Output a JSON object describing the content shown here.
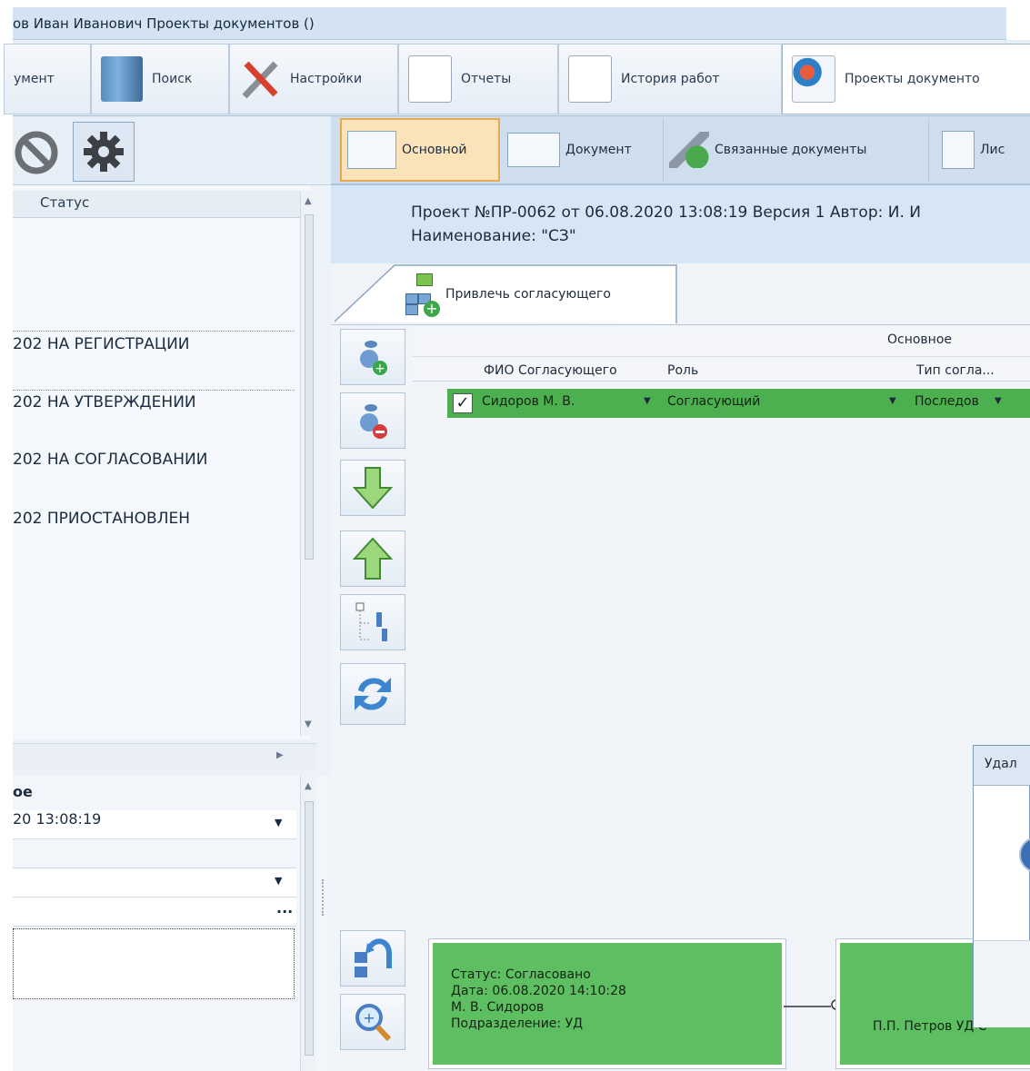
{
  "window": {
    "title": "ов Иван Иванович  Проекты документов ()"
  },
  "ribbon": {
    "tabs": [
      {
        "label": "умент",
        "icon": "document-icon"
      },
      {
        "label": "Поиск",
        "icon": "search-icon"
      },
      {
        "label": "Настройки",
        "icon": "settings-tools-icon"
      },
      {
        "label": "Отчеты",
        "icon": "reports-icon"
      },
      {
        "label": "История работ",
        "icon": "history-icon"
      },
      {
        "label": "Проекты документо",
        "icon": "projects-icon"
      }
    ]
  },
  "left_panel": {
    "toolbar": {
      "icons": [
        "cancel-icon",
        "gear-icon"
      ]
    },
    "list": {
      "column_header": "Статус",
      "rows": [
        {
          "date": "202",
          "status": "НА РЕГИСТРАЦИИ"
        },
        {
          "date": "202",
          "status": "НА УТВЕРЖДЕНИИ"
        },
        {
          "date": "202",
          "status": "НА СОГЛАСОВАНИИ"
        },
        {
          "date": "202",
          "status": "ПРИОСТАНОВЛЕН"
        }
      ]
    },
    "properties": {
      "header": "ое",
      "date_value": "20 13:08:19",
      "ellipsis": "..."
    }
  },
  "main": {
    "tabs": [
      {
        "label": "Основной",
        "active": true
      },
      {
        "label": "Документ"
      },
      {
        "label": "Связанные документы"
      },
      {
        "label": "Лис"
      }
    ],
    "project_line": "Проект №ПР-0062 от 06.08.2020 13:08:19 Версия 1 Автор: И. И",
    "name_line": "Наименование: \"СЗ\"",
    "subtab_label": "Привлечь согласующего",
    "grid": {
      "group_header": "Основное",
      "columns": [
        "ФИО Согласующего",
        "Роль",
        "Тип согла..."
      ],
      "row": {
        "checked": true,
        "fio": "Сидоров М. В.",
        "role": "Согласующий",
        "type": "Последов"
      }
    },
    "diagram": {
      "card1": {
        "status": "Статус: Согласовано",
        "date": "Дата: 06.08.2020 14:10:28",
        "person": "М. В. Сидоров",
        "department": "Подразделение: УД"
      },
      "card2_text": "П.П. Петров УД С"
    },
    "dialog_title": "Удал"
  },
  "colors": {
    "accent_green": "#4caf50",
    "active_tab": "#fbe3b9",
    "panel_blue": "#d7e6f5"
  }
}
